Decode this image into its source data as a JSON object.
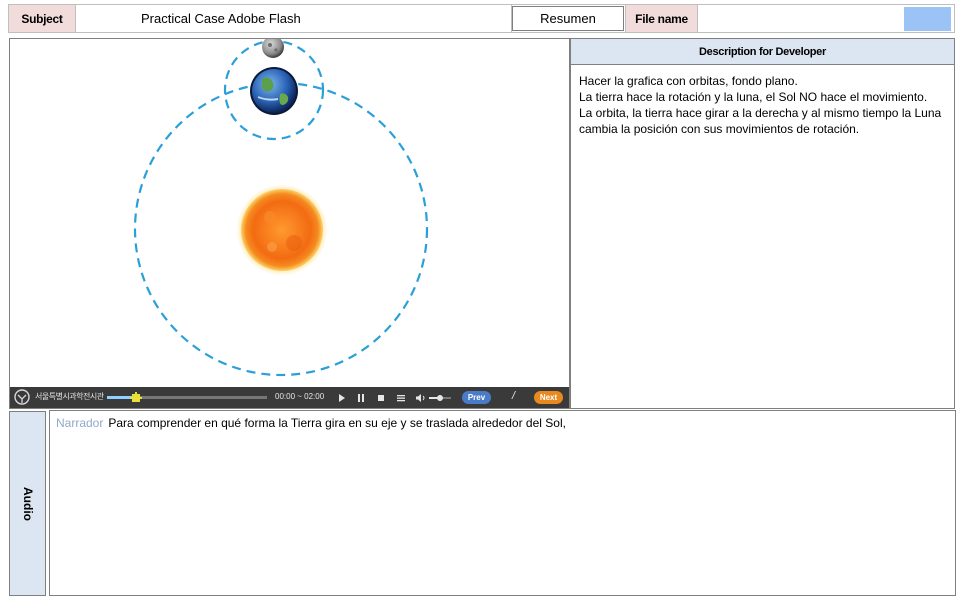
{
  "header": {
    "subject_label": "Subject",
    "subject_value": "Practical Case Adobe Flash",
    "resumen_label": "Resumen",
    "file_name_label": "File name",
    "file_name_value": ""
  },
  "player": {
    "logo_text": "서울특별시과학전시관",
    "time_text": "00:00 ~ 02:00",
    "prev_label": "Prev",
    "separator": "/",
    "next_label": "Next",
    "progress": 0.18,
    "volume": 0.5
  },
  "description": {
    "title": "Description for Developer",
    "lines": [
      "Hacer la grafica con orbitas, fondo plano.",
      "La tierra hace la rotación y la luna, el Sol NO hace el movimiento.",
      "La orbita, la tierra hace girar a la derecha  y al mismo tiempo la Luna cambia la posición con sus movimientos de rotación."
    ]
  },
  "audio": {
    "label": "Audio",
    "narrator_tag": "Narrador",
    "narration": "Para comprender en qué forma la Tierra  gira en su eje y se traslada alrededor del Sol,"
  },
  "colors": {
    "label_pink": "#f2dcdb",
    "label_blue": "#dce6f2",
    "orbit": "#2a9fd8",
    "sun": "#f5761a",
    "player_bg": "#3a3a3a",
    "next_btn": "#e8891f",
    "prev_btn": "#4a7bc8"
  }
}
